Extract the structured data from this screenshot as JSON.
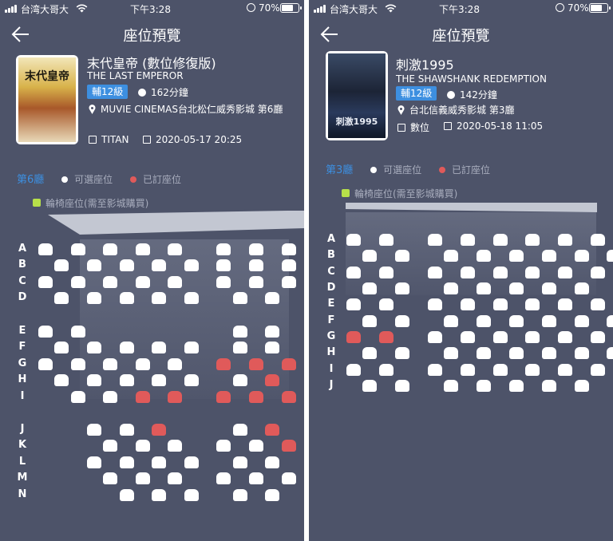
{
  "screens": [
    {
      "status": {
        "carrier": "台湾大哥大",
        "time": "下午3:28",
        "battery": "70%"
      },
      "nav": {
        "title": "座位預覽"
      },
      "movie": {
        "title": "末代皇帝 (數位修復版)",
        "subtitle": "THE LAST EMPEROR",
        "rating": "輔12級",
        "runtime": "162分鐘",
        "cinema": "MUVIE CINEMAS台北松仁威秀影城 第6廳",
        "format": "TITAN",
        "datetime": "2020-05-17 20:25",
        "poster_title": "末代皇帝"
      },
      "legend": {
        "hall": "第6廳",
        "available": "可選座位",
        "booked": "已訂座位",
        "wheelchair": "輪椅座位(需至影城購買)"
      },
      "row_labels": [
        "A",
        "B",
        "C",
        "D",
        "E",
        "F",
        "G",
        "H",
        "I",
        "J",
        "K",
        "L",
        "M",
        "N"
      ],
      "colors": {
        "background": "#4d5369",
        "accent": "#3d8fe0",
        "booked": "#e05a5a",
        "seat": "#ffffff"
      },
      "seat_rows": [
        {
          "row": "A",
          "seats": [
            0,
            2,
            4,
            6,
            8,
            11,
            13,
            15
          ],
          "booked": []
        },
        {
          "row": "B",
          "seats": [
            1,
            3,
            5,
            7,
            9,
            11,
            13,
            15
          ],
          "booked": []
        },
        {
          "row": "C",
          "seats": [
            0,
            2,
            4,
            6,
            8,
            11,
            13,
            15
          ],
          "booked": []
        },
        {
          "row": "D",
          "seats": [
            1,
            3,
            5,
            7,
            9,
            12,
            14
          ],
          "booked": []
        },
        {
          "row": "E",
          "seats": [
            0,
            2,
            12,
            14
          ],
          "booked": []
        },
        {
          "row": "F",
          "seats": [
            1,
            3,
            5,
            7,
            9,
            12,
            14
          ],
          "booked": []
        },
        {
          "row": "G",
          "seats": [
            0,
            2,
            4,
            6,
            8
          ],
          "booked": [
            11,
            13,
            15
          ]
        },
        {
          "row": "H",
          "seats": [
            1,
            3,
            5,
            7,
            9,
            12
          ],
          "booked": [
            14
          ]
        },
        {
          "row": "I",
          "seats": [
            2,
            4
          ],
          "booked": [
            6,
            8,
            11,
            13,
            15
          ]
        },
        {
          "row": "J",
          "seats": [
            3,
            5,
            12
          ],
          "booked": [
            7,
            14
          ]
        },
        {
          "row": "K",
          "seats": [
            4,
            6,
            8,
            11,
            13
          ],
          "booked": [
            15
          ]
        },
        {
          "row": "L",
          "seats": [
            3,
            5,
            7,
            9,
            12,
            14
          ],
          "booked": []
        },
        {
          "row": "M",
          "seats": [
            4,
            6,
            8,
            11,
            13,
            15
          ],
          "booked": []
        },
        {
          "row": "N",
          "seats": [
            5,
            7,
            9,
            12,
            14
          ],
          "booked": []
        }
      ]
    },
    {
      "status": {
        "carrier": "台湾大哥大",
        "time": "下午3:28",
        "battery": "70%"
      },
      "nav": {
        "title": "座位預覽"
      },
      "movie": {
        "title": "刺激1995",
        "subtitle": "THE SHAWSHANK REDEMPTION",
        "rating": "輔12級",
        "runtime": "142分鐘",
        "cinema": "台北信義威秀影城 第3廳",
        "format": "數位",
        "datetime": "2020-05-18 11:05",
        "poster_title": "刺激1995"
      },
      "legend": {
        "hall": "第3廳",
        "available": "可選座位",
        "booked": "已訂座位",
        "wheelchair": "輪椅座位(需至影城購買)"
      },
      "row_labels": [
        "A",
        "B",
        "C",
        "D",
        "E",
        "F",
        "G",
        "H",
        "I",
        "J"
      ],
      "colors": {
        "background": "#4d5369",
        "accent": "#3d8fe0",
        "booked": "#e05a5a",
        "seat": "#ffffff"
      },
      "seat_rows": [
        {
          "row": "A",
          "seats": [
            0,
            2,
            5,
            7,
            9,
            11,
            13,
            15
          ],
          "booked": []
        },
        {
          "row": "B",
          "seats": [
            1,
            3,
            6,
            8,
            10,
            12,
            14,
            16
          ],
          "booked": []
        },
        {
          "row": "C",
          "seats": [
            0,
            2,
            5,
            7,
            9,
            11,
            13,
            15
          ],
          "booked": []
        },
        {
          "row": "D",
          "seats": [
            1,
            3,
            6,
            8,
            10,
            12,
            14
          ],
          "booked": []
        },
        {
          "row": "E",
          "seats": [
            0,
            2,
            5,
            7,
            9,
            11,
            13,
            15
          ],
          "booked": []
        },
        {
          "row": "F",
          "seats": [
            1,
            3,
            6,
            8,
            10,
            12,
            14,
            16
          ],
          "booked": []
        },
        {
          "row": "G",
          "seats": [
            5,
            7,
            9,
            11,
            13,
            15
          ],
          "booked": [
            0,
            2
          ]
        },
        {
          "row": "H",
          "seats": [
            1,
            3,
            6,
            8,
            10,
            12,
            14,
            16
          ],
          "booked": []
        },
        {
          "row": "I",
          "seats": [
            0,
            2,
            5,
            7,
            9,
            11,
            13,
            15
          ],
          "booked": []
        },
        {
          "row": "J",
          "seats": [
            1,
            3,
            6,
            8,
            10,
            12,
            14
          ],
          "booked": []
        }
      ]
    }
  ]
}
